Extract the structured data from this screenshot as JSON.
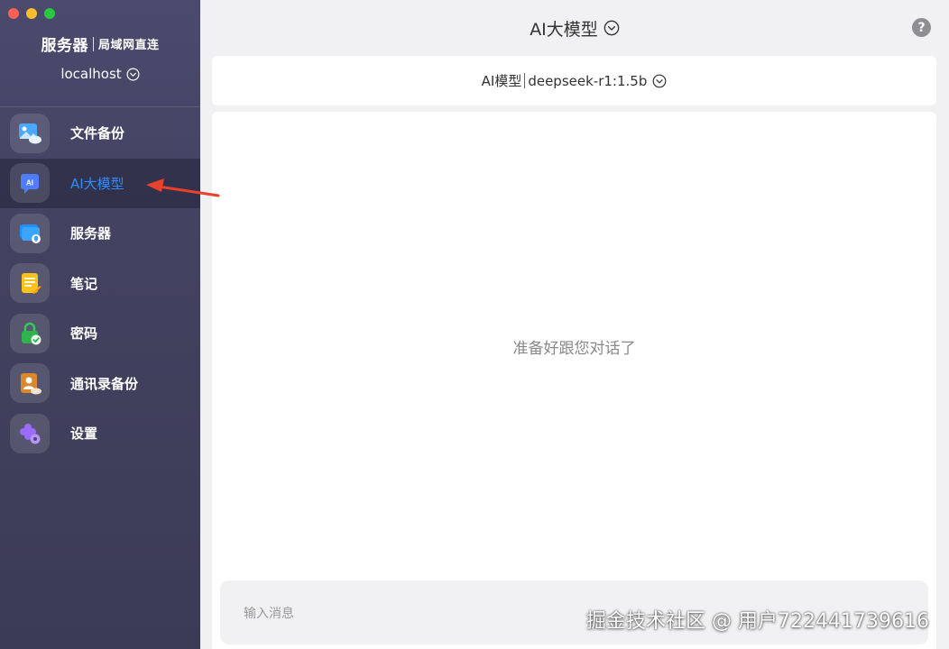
{
  "sidebar": {
    "server_title": "服务器",
    "connection_mode": "局域网直连",
    "host": "localhost",
    "items": [
      {
        "label": "文件备份",
        "icon": "photo-backup-icon"
      },
      {
        "label": "AI大模型",
        "icon": "ai-chat-icon"
      },
      {
        "label": "服务器",
        "icon": "server-icon"
      },
      {
        "label": "笔记",
        "icon": "notes-icon"
      },
      {
        "label": "密码",
        "icon": "password-lock-icon"
      },
      {
        "label": "通讯录备份",
        "icon": "contacts-backup-icon"
      },
      {
        "label": "设置",
        "icon": "settings-gear-icon"
      }
    ],
    "active_index": 1
  },
  "header": {
    "title": "AI大模型",
    "help_label": "?"
  },
  "model_bar": {
    "prefix": "AI模型",
    "model": "deepseek-r1:1.5b"
  },
  "chat": {
    "empty_text": "准备好跟您对话了",
    "input_placeholder": "输入消息"
  },
  "watermark": "掘金技术社区 @ 用户722441739616",
  "colors": {
    "sidebar_bg": "#45445f",
    "active_label": "#2f8cff",
    "arrow": "#e8412c"
  }
}
